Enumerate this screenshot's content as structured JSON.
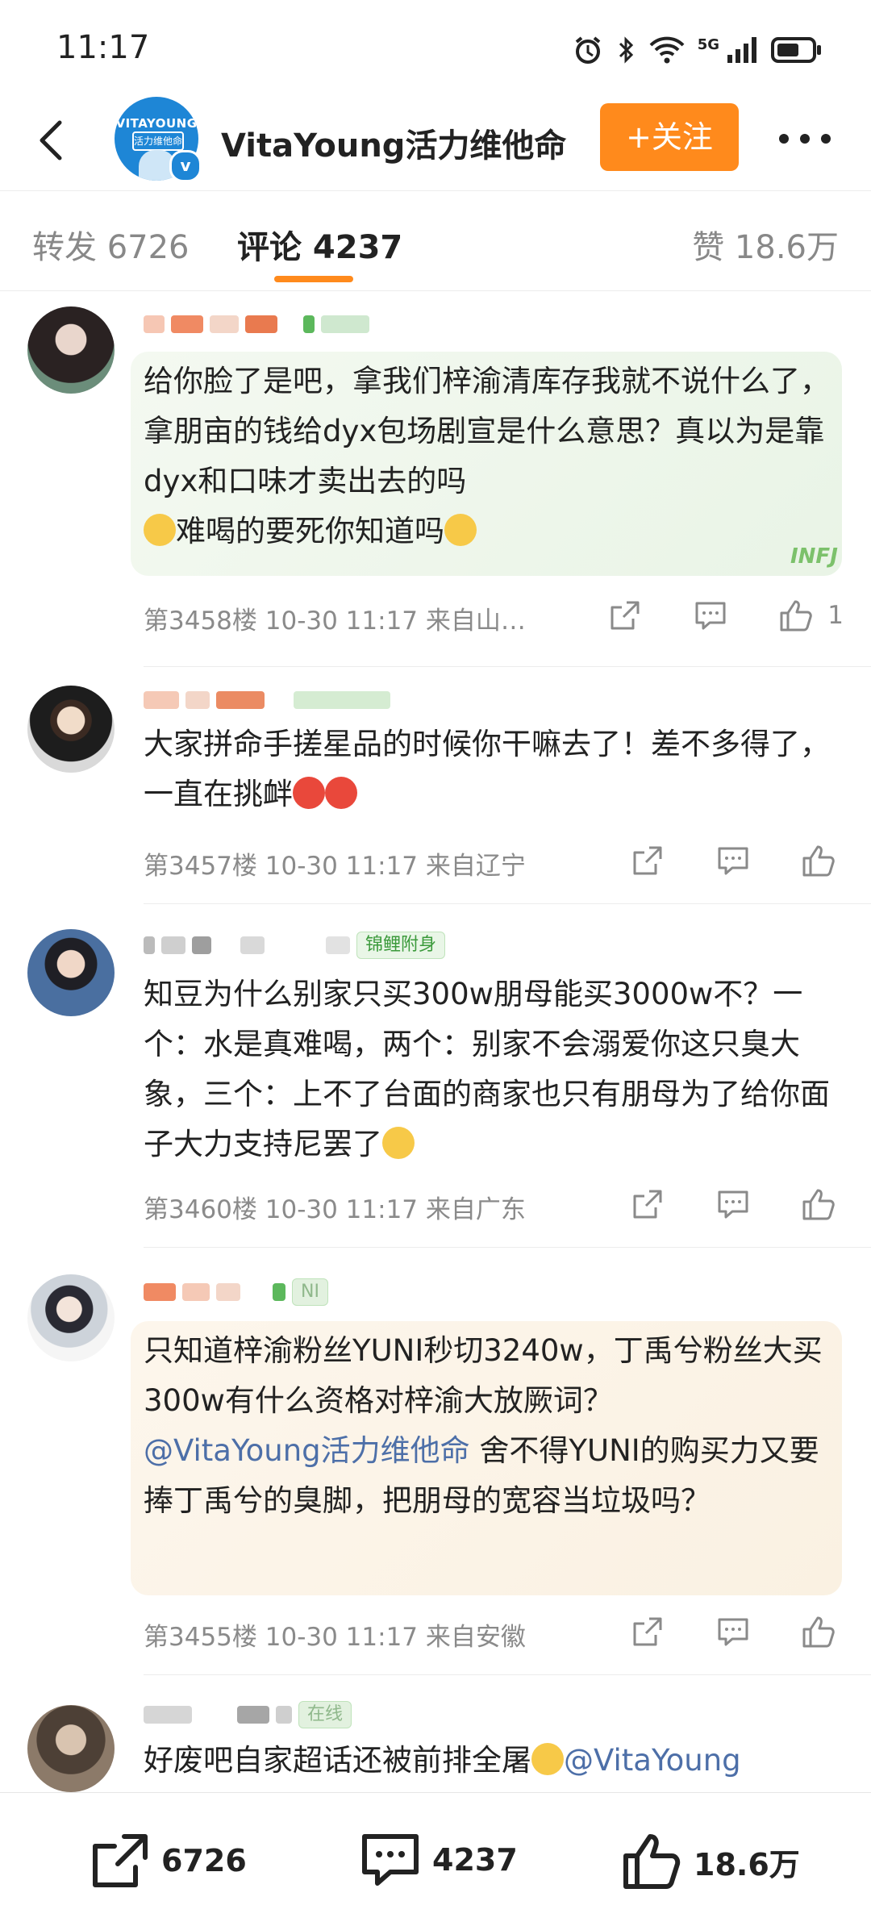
{
  "status": {
    "time": "11:17",
    "net": "5G"
  },
  "header": {
    "avatar_text_1": "VITAYOUNG",
    "avatar_text_2": "活力维他命",
    "title": "VitaYoung活力维他命",
    "follow": "+关注"
  },
  "tabs": {
    "repost": "转发 6726",
    "comments": "评论 4237",
    "likes": "赞 18.6万"
  },
  "comments": [
    {
      "text": "给你脸了是吧，拿我们梓渝清库存我就不说什么了，拿朋亩的钱给dyx包场剧宣是什么意思？真以为是靠dyx和口味才卖出去的吗",
      "text_tail": "难喝的要死你知道吗",
      "card_tag": "INFJ",
      "meta": "第3458楼  10-30 11:17  来自山…",
      "likes": "1"
    },
    {
      "text": "大家拼命手搓星品的时候你干嘛去了！差不多得了，一直在挑衅",
      "meta": "第3457楼  10-30 11:17  来自辽宁",
      "likes": ""
    },
    {
      "badge": "锦鲤附身",
      "text": "知豆为什么别家只买300w朋母能买3000w不？一个：水是真难喝，两个：别家不会溺爱你这只臭大象，三个：上不了台面的商家也只有朋母为了给你面子大力支持尼罢了",
      "meta": "第3460楼  10-30 11:17  来自广东",
      "likes": ""
    },
    {
      "badge": "NI",
      "text_a": "只知道梓渝粉丝YUNI秒切3240w，丁禹兮粉丝大买300w有什么资格对梓渝大放厥词？",
      "mention": "@VitaYoung活力维他命",
      "text_b": " 舍不得YUNI的购买力又要捧丁禹兮的臭脚，把朋母的宽容当垃圾吗？",
      "meta": "第3455楼  10-30 11:17  来自安徽",
      "likes": ""
    },
    {
      "badge": "在线",
      "text": "好废吧自家超话还被前排全屠",
      "mention": "@VitaYoung"
    }
  ],
  "bottom": {
    "reposts": "6726",
    "comments": "4237",
    "likes": "18.6万"
  }
}
